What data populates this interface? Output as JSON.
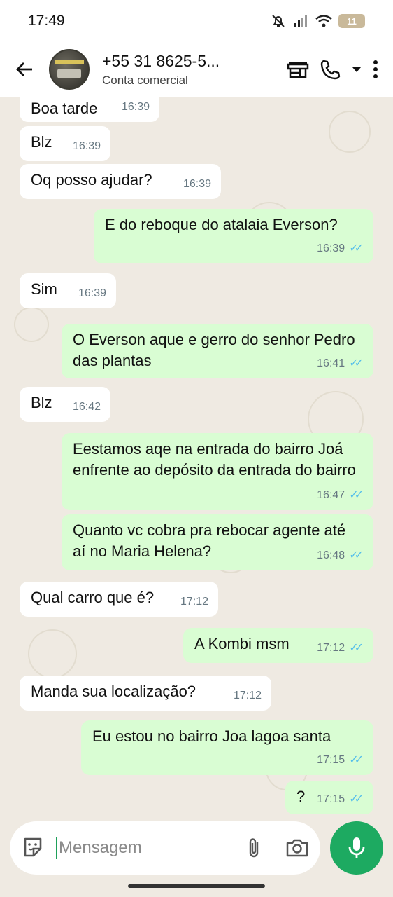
{
  "status_bar": {
    "time": "17:49",
    "battery": "11"
  },
  "header": {
    "contact_name": "+55 31 8625-5...",
    "subtitle": "Conta comercial"
  },
  "messages": [
    {
      "dir": "in",
      "text": "Boa tarde",
      "time": "16:39"
    },
    {
      "dir": "in",
      "text": "Blz",
      "time": "16:39"
    },
    {
      "dir": "in",
      "text": "Oq posso ajudar?",
      "time": "16:39"
    },
    {
      "dir": "out",
      "text": "E do reboque do atalaia Everson?",
      "time": "16:39"
    },
    {
      "dir": "in",
      "text": "Sim",
      "time": "16:39"
    },
    {
      "dir": "out",
      "text": "O Everson aque e gerro do senhor Pedro das plantas",
      "time": "16:41"
    },
    {
      "dir": "in",
      "text": "Blz",
      "time": "16:42"
    },
    {
      "dir": "out",
      "text": "Eestamos aqe na entrada do bairro Joá enfrente ao depósito da entrada do bairro",
      "time": "16:47"
    },
    {
      "dir": "out",
      "text": "Quanto vc cobra pra rebocar agente até aí no Maria Helena?",
      "time": "16:48"
    },
    {
      "dir": "in",
      "text": "Qual carro que é?",
      "time": "17:12"
    },
    {
      "dir": "out",
      "text": "A Kombi msm",
      "time": "17:12"
    },
    {
      "dir": "in",
      "text": "Manda sua localização?",
      "time": "17:12"
    },
    {
      "dir": "out",
      "text": "Eu estou no bairro Joa lagoa santa",
      "time": "17:15"
    },
    {
      "dir": "out",
      "text": "?",
      "time": "17:15"
    }
  ],
  "composer": {
    "placeholder": "Mensagem"
  },
  "colors": {
    "chat_background": "#efeae2",
    "outgoing_bubble": "#d9fdd3",
    "incoming_bubble": "#ffffff",
    "read_ticks": "#53bdeb",
    "mic_button": "#1daa61"
  }
}
